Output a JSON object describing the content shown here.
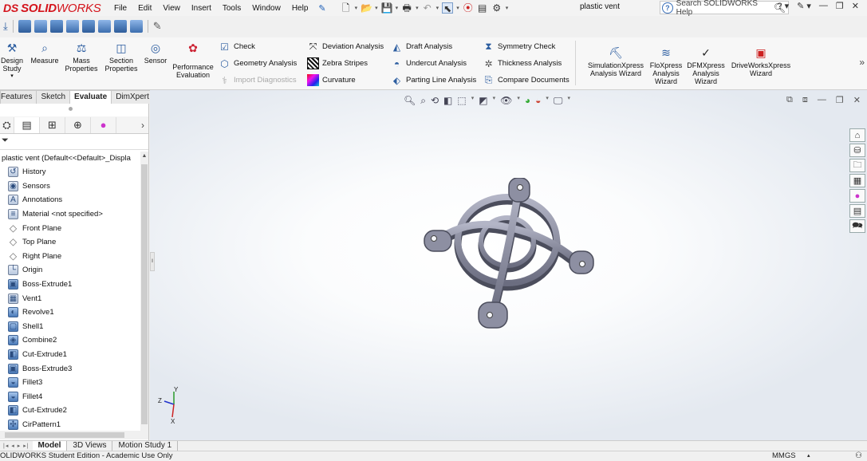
{
  "app": {
    "logo_ds": "DS",
    "logo_solid": "SOLID",
    "logo_works": "WORKS",
    "document_title": "plastic vent"
  },
  "menu": [
    "File",
    "Edit",
    "View",
    "Insert",
    "Tools",
    "Window",
    "Help"
  ],
  "search": {
    "placeholder": "Search SOLIDWORKS Help"
  },
  "command_manager": {
    "big_buttons": [
      {
        "label": "Design Study",
        "icon": "design-study-icon"
      },
      {
        "label": "Measure",
        "icon": "measure-icon"
      },
      {
        "label": "Mass Properties",
        "icon": "mass-properties-icon"
      },
      {
        "label": "Section Properties",
        "icon": "section-properties-icon"
      },
      {
        "label": "Sensor",
        "icon": "sensor-icon"
      },
      {
        "label": "Performance Evaluation",
        "icon": "performance-evaluation-icon"
      }
    ],
    "col1": [
      "Check",
      "Geometry Analysis",
      "Import Diagnostics"
    ],
    "col2": [
      "Deviation Analysis",
      "Zebra Stripes",
      "Curvature"
    ],
    "col3": [
      "Draft Analysis",
      "Undercut Analysis",
      "Parting Line Analysis"
    ],
    "col4": [
      "Symmetry Check",
      "Thickness Analysis",
      "Compare Documents"
    ],
    "wizards": [
      {
        "label": "SimulationXpress Analysis Wizard"
      },
      {
        "label": "FloXpress Analysis Wizard"
      },
      {
        "label": "DFMXpress Analysis Wizard"
      },
      {
        "label": "DriveWorksXpress Wizard"
      }
    ]
  },
  "tabs": [
    {
      "label": "Features",
      "active": false
    },
    {
      "label": "Sketch",
      "active": false
    },
    {
      "label": "Evaluate",
      "active": true
    },
    {
      "label": "DimXpert",
      "active": false
    }
  ],
  "feature_tree": {
    "root": "plastic vent  (Default<<Default>_Displa",
    "items": [
      {
        "label": "History",
        "icon": "history-icon"
      },
      {
        "label": "Sensors",
        "icon": "sensors-icon"
      },
      {
        "label": "Annotations",
        "icon": "annotations-icon"
      },
      {
        "label": "Material <not specified>",
        "icon": "material-icon"
      },
      {
        "label": "Front Plane",
        "icon": "plane-icon"
      },
      {
        "label": "Top Plane",
        "icon": "plane-icon"
      },
      {
        "label": "Right Plane",
        "icon": "plane-icon"
      },
      {
        "label": "Origin",
        "icon": "origin-icon"
      },
      {
        "label": "Boss-Extrude1",
        "icon": "extrude-icon"
      },
      {
        "label": "Vent1",
        "icon": "vent-icon"
      },
      {
        "label": "Revolve1",
        "icon": "revolve-icon"
      },
      {
        "label": "Shell1",
        "icon": "shell-icon"
      },
      {
        "label": "Combine2",
        "icon": "combine-icon"
      },
      {
        "label": "Cut-Extrude1",
        "icon": "cut-extrude-icon"
      },
      {
        "label": "Boss-Extrude3",
        "icon": "extrude-icon"
      },
      {
        "label": "Fillet3",
        "icon": "fillet-icon"
      },
      {
        "label": "Fillet4",
        "icon": "fillet-icon"
      },
      {
        "label": "Cut-Extrude2",
        "icon": "cut-extrude-icon"
      },
      {
        "label": "CirPattern1",
        "icon": "circular-pattern-icon"
      }
    ]
  },
  "triad": {
    "z": "Z",
    "y": "Y",
    "x": "X"
  },
  "bottom_tabs": [
    {
      "label": "Model",
      "active": true
    },
    {
      "label": "3D Views",
      "active": false
    },
    {
      "label": "Motion Study 1",
      "active": false
    }
  ],
  "status": {
    "text": "OLIDWORKS Student Edition - Academic Use Only",
    "units": "MMGS"
  }
}
